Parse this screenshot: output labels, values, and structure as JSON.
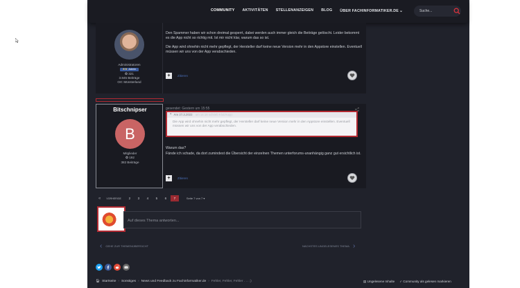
{
  "nav": {
    "items": [
      "COMMUNITY",
      "AKTIVITÄTEN",
      "STELLENANZEIGEN",
      "BLOG",
      "ÜBER FACHINFORMATIKER.DE"
    ],
    "dropdown_icon": "chevron-down-icon"
  },
  "search": {
    "placeholder": "Suche..."
  },
  "post1": {
    "role": "Administratoren",
    "badge": "Admin",
    "reputation": "321",
    "posts": "3.845 Beiträge",
    "location": "Ort: Münsterland",
    "paragraphs": [
      "Den Spammer haben wir schon dreimal gesperrt, dabei werden auch immer gleich die Beiträge gelöscht. Leider bekommt es die App nicht so richtig mit. Ist mir nicht klar, warum das so ist.",
      "Die App wird ohnehin nicht mehr gepflegt, der Hersteller darf keine neue Version mehr in den Appstore einstellen. Eventuell müssen wir uns von der App verabschieden."
    ],
    "quote_label": "Zitieren"
  },
  "post2": {
    "author": "Bitschnipser",
    "avatar_letter": "B",
    "role": "Mitglieder",
    "reputation": "192",
    "posts": "382 Beiträge",
    "date": "gesendet: Gestern um 15:55",
    "quote_head_name": "Am 27.3.2022",
    "quote_head_rest": "um 14:18 schrieb Klotzkopp:",
    "quote_text": "Die App wird ohnehin nicht mehr gepflegt, der Hersteller darf keine neue Version mehr in den Appstore einstellen. Eventuell müssen wir uns von der App verabschieden.",
    "paragraphs": [
      "Warum das?",
      "Fände ich schade, da dort zumindest die Übersicht der einzelnen Themen unterforums-unanhängig ganz gut ersichtlich ist."
    ],
    "quote_label": "Zitieren"
  },
  "pagination": {
    "prev_label": "VORHERIGE",
    "pages": [
      "2",
      "3",
      "4",
      "5",
      "6",
      "7"
    ],
    "current": "7",
    "page_of": "Seite 7 von 7"
  },
  "reply": {
    "placeholder": "Auf dieses Thema antworten..."
  },
  "thread_nav": {
    "prev": "GEHE ZUR THEMENÜBERSICHT",
    "next": "NÄCHSTES UNGELESENES THEMA"
  },
  "breadcrumb": {
    "items": [
      "Startseite",
      "Sonstiges",
      "News und Feedback zu Fachinformatiker.de",
      "Fehler, Fehler, Fehler . . . ;)"
    ],
    "unread": "Ungelesene Inhalte",
    "mark_read": "Community als gelesen markieren"
  },
  "colors": {
    "accent": "#b32a32",
    "panel": "#191a21",
    "background": "#20222b"
  }
}
